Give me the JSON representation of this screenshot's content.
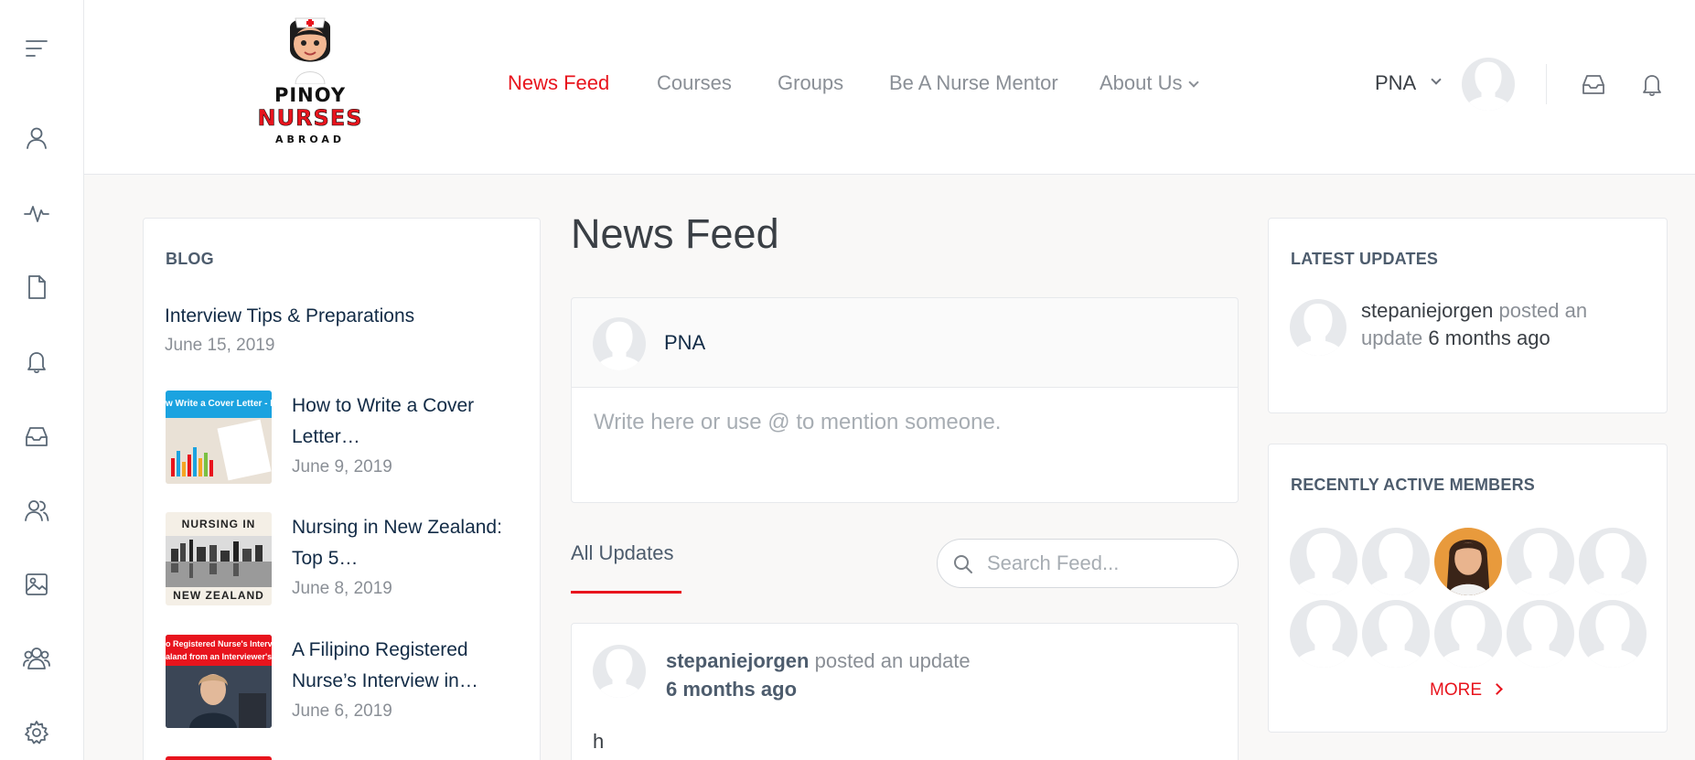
{
  "sidebar": {
    "icons": [
      "menu-toggle-icon",
      "profile-icon",
      "activity-icon",
      "document-icon",
      "bell-icon",
      "inbox-icon",
      "groups-icon",
      "photos-icon",
      "members-icon",
      "settings-icon"
    ]
  },
  "header": {
    "logo": {
      "line1": "PINOY",
      "line2": "NURSES",
      "line3": "ABROAD"
    },
    "nav": [
      {
        "label": "News Feed",
        "active": true
      },
      {
        "label": "Courses"
      },
      {
        "label": "Groups"
      },
      {
        "label": "Be A Nurse Mentor"
      },
      {
        "label": "About Us",
        "has_dropdown": true
      }
    ],
    "user_name": "PNA",
    "icons": [
      "inbox-icon",
      "bell-icon"
    ]
  },
  "blog": {
    "title": "BLOG",
    "posts": [
      {
        "title": "Interview Tips & Preparations",
        "date": "June 15, 2019"
      },
      {
        "title_line1": "How to Write a Cover",
        "title_line2": "Letter…",
        "date": "June 9, 2019",
        "thumb_text": "w Write a Cover Letter - NZ"
      },
      {
        "title_line1": "Nursing in New Zealand:",
        "title_line2": "Top 5…",
        "date": "June 8, 2019",
        "thumb_top": "NURSING IN",
        "thumb_bottom": "NEW ZEALAND"
      },
      {
        "title_line1": "A Filipino Registered",
        "title_line2": "Nurse’s Interview in…",
        "date": "June 6, 2019",
        "thumb_line1": "o Registered Nurse's Intervie",
        "thumb_line2": "aland from an Interviewer's Ey"
      }
    ]
  },
  "feed": {
    "page_title": "News Feed",
    "composer_name": "PNA",
    "composer_placeholder": "Write here or use @ to mention someone.",
    "tab_all": "All Updates",
    "search_placeholder": "Search Feed...",
    "post": {
      "user": "stepaniejorgen",
      "action": "posted an update",
      "time": "6 months ago",
      "text": "h"
    }
  },
  "latest_updates": {
    "title": "LATEST UPDATES",
    "user": "stepaniejorgen",
    "action": "posted an update",
    "time": "6 months ago"
  },
  "active_members": {
    "title": "RECENTLY ACTIVE MEMBERS",
    "more_label": "MORE",
    "count": 10
  },
  "colors": {
    "accent": "#e8141d",
    "text_dark": "#122b46",
    "text_muted": "#8a8f96",
    "page_bg": "#f9f8f7"
  }
}
